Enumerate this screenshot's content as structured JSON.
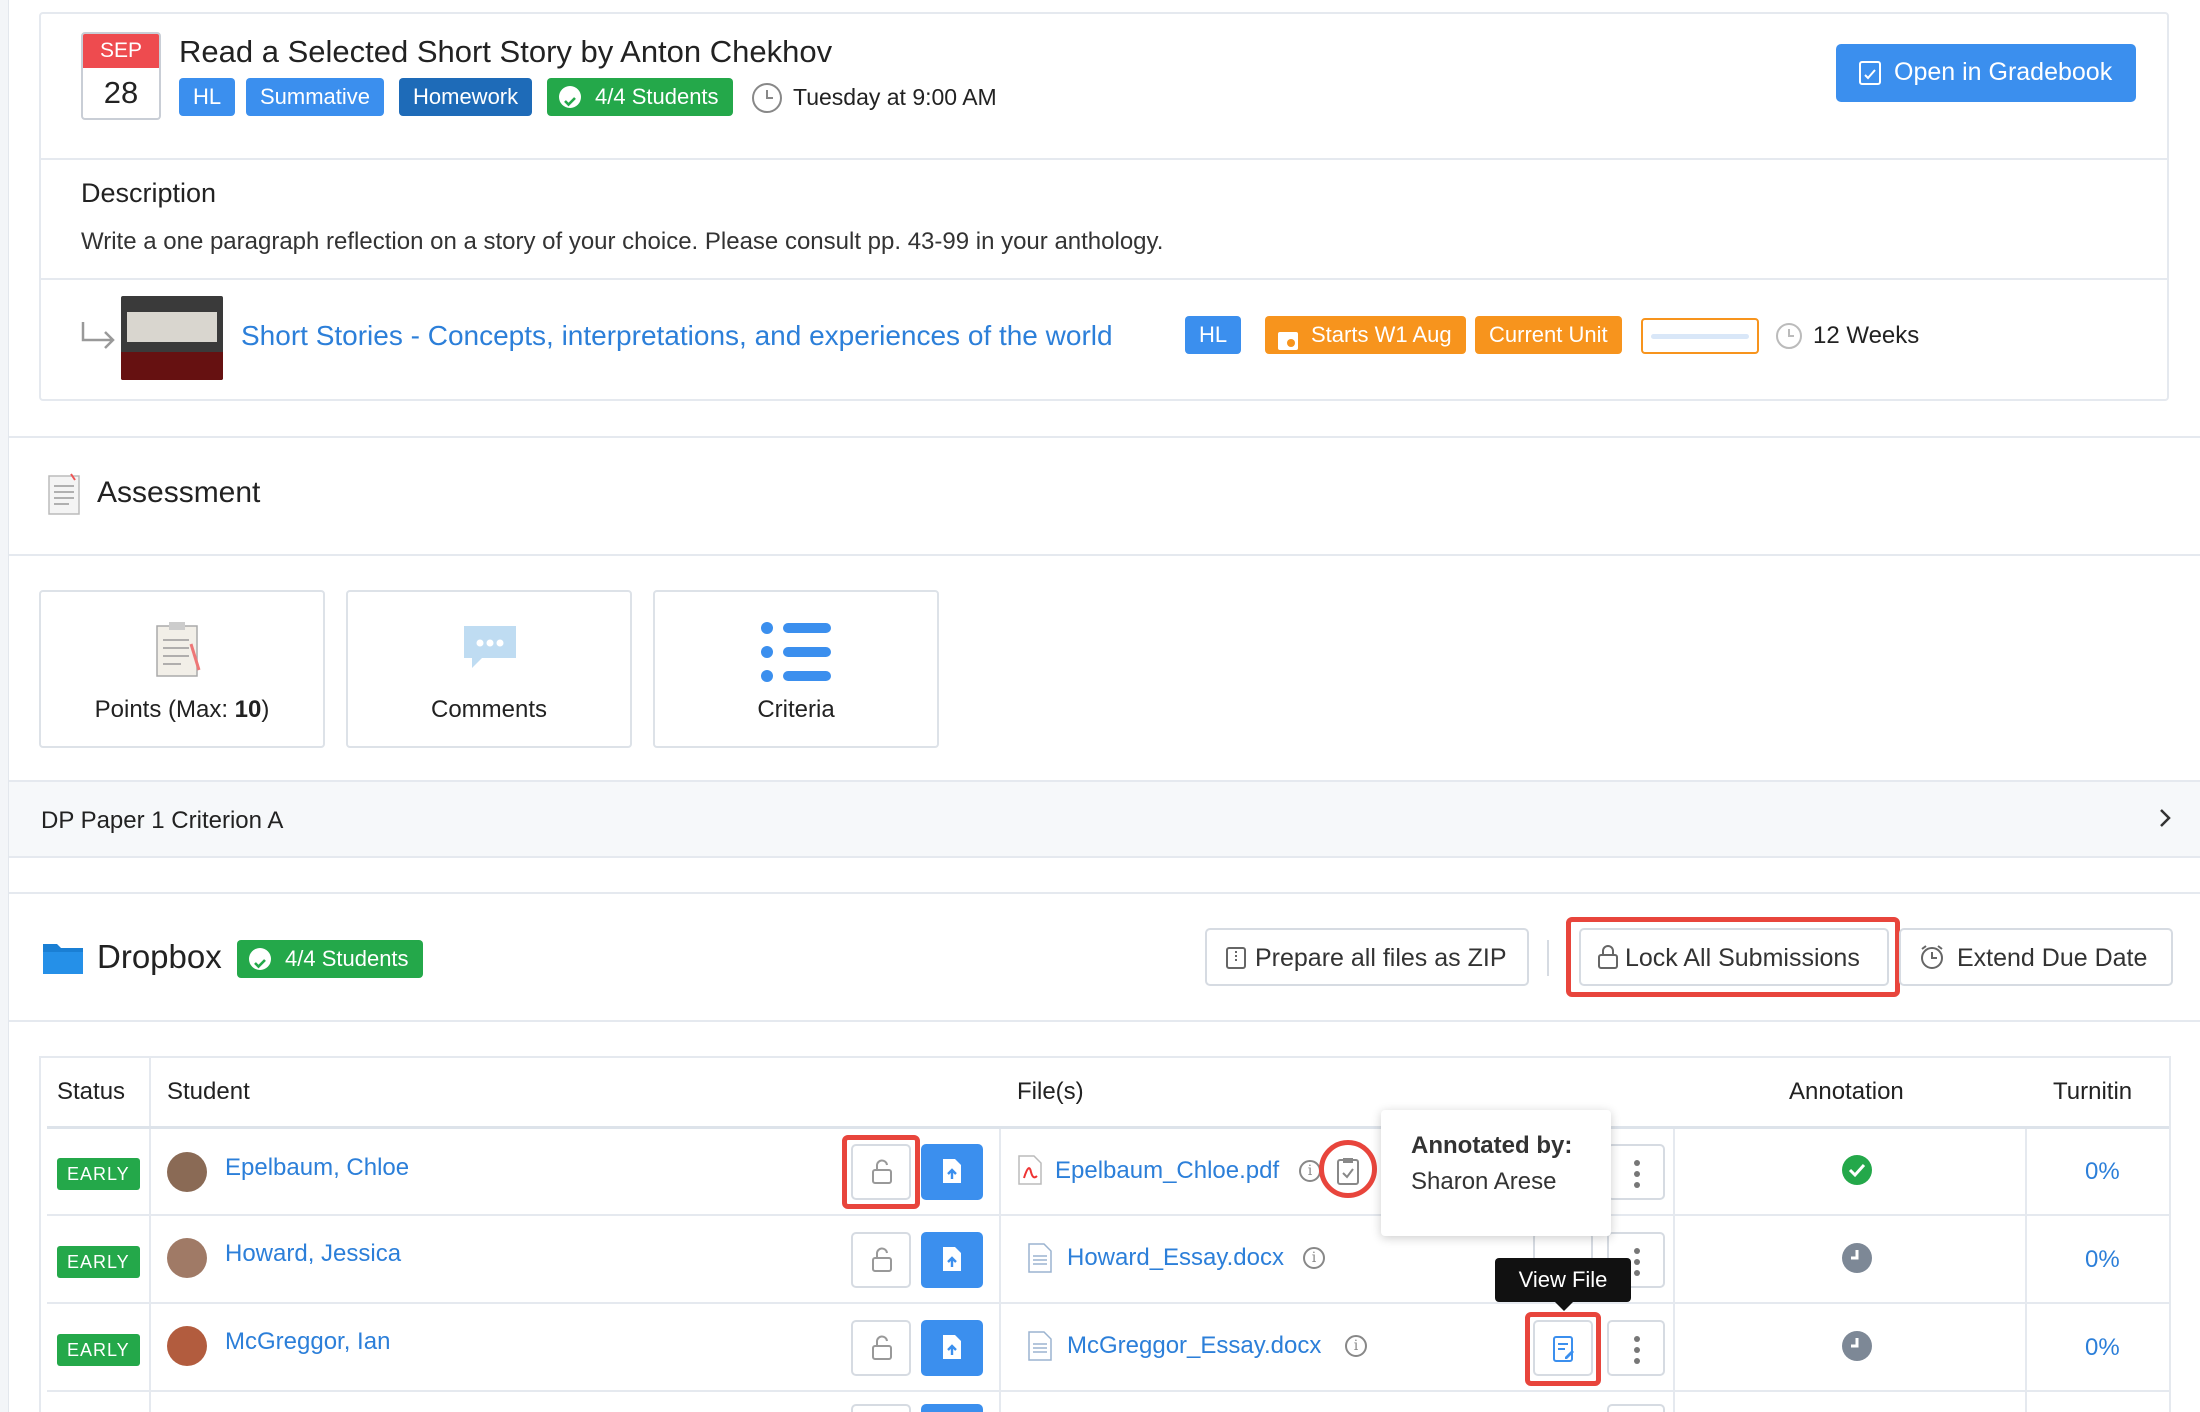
{
  "assignment": {
    "date_month": "SEP",
    "date_day": "28",
    "title": "Read a Selected Short Story by Anton Chekhov",
    "tags": [
      "HL",
      "Summative",
      "Homework"
    ],
    "students_badge": "4/4 Students",
    "due": "Tuesday at 9:00 AM",
    "gradebook_button": "Open in Gradebook"
  },
  "description": {
    "heading": "Description",
    "text": "Write a one paragraph reflection on a story of your choice. Please consult pp. 43-99 in your anthology."
  },
  "unit": {
    "link": "Short Stories - Concepts, interpretations, and experiences of the world",
    "level_tag": "HL",
    "starts_tag": "Starts W1 Aug",
    "current_tag": "Current Unit",
    "progress": 0,
    "duration": "12 Weeks"
  },
  "assessment": {
    "heading": "Assessment",
    "points_label": "Points (Max: ",
    "points_max": "10",
    "points_close": ")",
    "comments_label": "Comments",
    "criteria_label": "Criteria",
    "criterion_row": "DP Paper 1 Criterion A"
  },
  "dropbox": {
    "heading": "Dropbox",
    "students_badge": "4/4 Students",
    "zip_button": "Prepare all files as ZIP",
    "lock_button": "Lock All Submissions",
    "extend_button": "Extend Due Date",
    "columns": [
      "Status",
      "Student",
      "File(s)",
      "Annotation",
      "Turnitin"
    ],
    "rows": [
      {
        "status": "EARLY",
        "student": "Epelbaum, Chloe",
        "file": "Epelbaum_Chloe.pdf",
        "annotation": "done",
        "turnitin": "0%"
      },
      {
        "status": "EARLY",
        "student": "Howard, Jessica",
        "file": "Howard_Essay.docx",
        "annotation": "pending",
        "turnitin": "0%"
      },
      {
        "status": "EARLY",
        "student": "McGreggor, Ian",
        "file": "McGreggor_Essay.docx",
        "annotation": "pending",
        "turnitin": "0%"
      }
    ],
    "tooltip_annotated_title": "Annotated by:",
    "tooltip_annotated_name": "Sharon Arese",
    "tooltip_view_file": "View File"
  },
  "colors": {
    "accent": "#3b8fee",
    "success": "#24a84a",
    "warning": "#f7941d",
    "danger": "#ee4b4f",
    "highlight": "#e8453c"
  }
}
